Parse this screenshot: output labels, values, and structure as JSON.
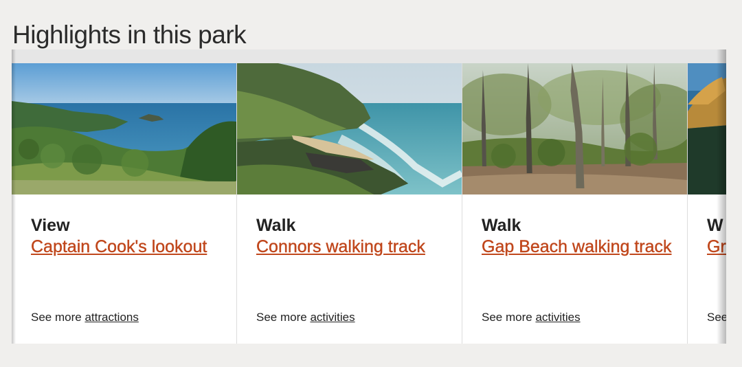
{
  "page": {
    "heading": "Highlights in this park"
  },
  "cards": [
    {
      "type": "View",
      "title": "Captain Cook's lookout",
      "see_more_prefix": "See more",
      "see_more_link": "attractions",
      "image": "coastal-lookout-photo"
    },
    {
      "type": "Walk",
      "title": "Connors walking track",
      "see_more_prefix": "See more",
      "see_more_link": "activities",
      "image": "beach-headland-photo"
    },
    {
      "type": "Walk",
      "title": "Gap Beach walking track",
      "see_more_prefix": "See more",
      "see_more_link": "activities",
      "image": "eucalyptus-forest-photo"
    },
    {
      "type": "W",
      "title": "Gr tra",
      "see_more_prefix": "See",
      "see_more_link": "",
      "image": "coastal-cliff-photo"
    }
  ],
  "colors": {
    "link": "#c0471c",
    "background": "#f0efed"
  }
}
